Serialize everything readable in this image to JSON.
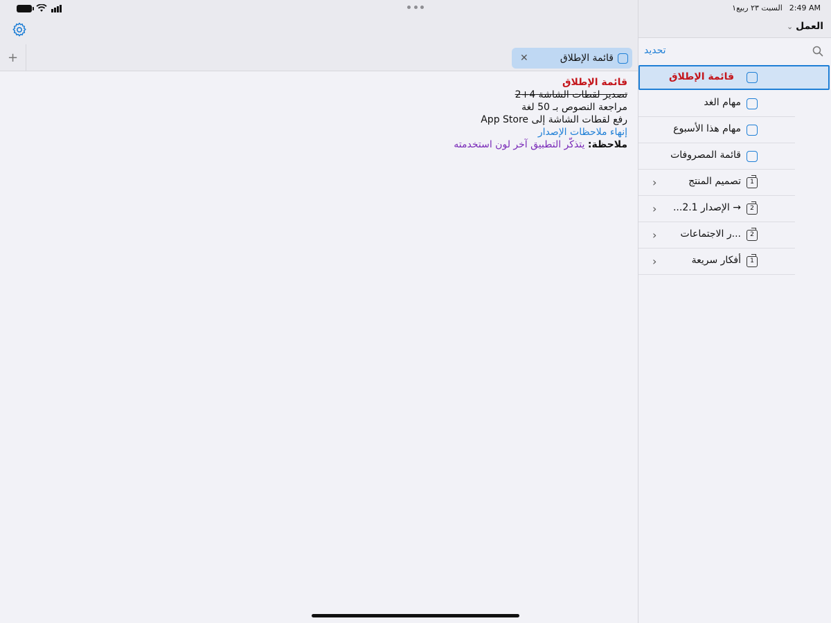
{
  "status": {
    "time": "2:49 AM",
    "date": "السبت ٢٣ ربيع١"
  },
  "tabstrip": {
    "add_label": "+",
    "tab": {
      "label": "قائمة الإطلاق",
      "close": "✕"
    }
  },
  "note": {
    "title": "قائمة الإطلاق",
    "lines": [
      "تصدير لقطات الشاشة 4+2",
      "مراجعة النصوص بـ 50 لغة",
      "رفع لقطات الشاشة إلى App Store",
      "إنهاء ملاحظات الإصدار"
    ],
    "note_label": "ملاحظة:",
    "note_text": " يتذكّر التطبيق آخر لون استخدمته"
  },
  "sidebar": {
    "title": "العمل",
    "edit_label": "تحديد",
    "items": [
      {
        "label": "قائمة الإطلاق",
        "icon": "note-icon",
        "selected": true
      },
      {
        "label": "مهام الغد",
        "icon": "note-icon"
      },
      {
        "label": "مهام هذا الأسبوع",
        "icon": "note-icon"
      },
      {
        "label": "قائمة المصروفات",
        "icon": "note-icon"
      },
      {
        "label": "تصميم المنتج",
        "icon": "stack-icon",
        "count": "1"
      },
      {
        "label": "→ الإصدار 2.1...",
        "icon": "stack-icon",
        "count": "2"
      },
      {
        "label": "...ر الاجتماعات",
        "icon": "stack-icon",
        "count": "2"
      },
      {
        "label": "أفكار سريعة",
        "icon": "stack-icon",
        "count": "1"
      }
    ]
  },
  "colors": {
    "accent": "#1e7fd6",
    "title_red": "#c4161c",
    "note_purple": "#7a2bb8",
    "selected_bg": "#d2e3f6"
  }
}
